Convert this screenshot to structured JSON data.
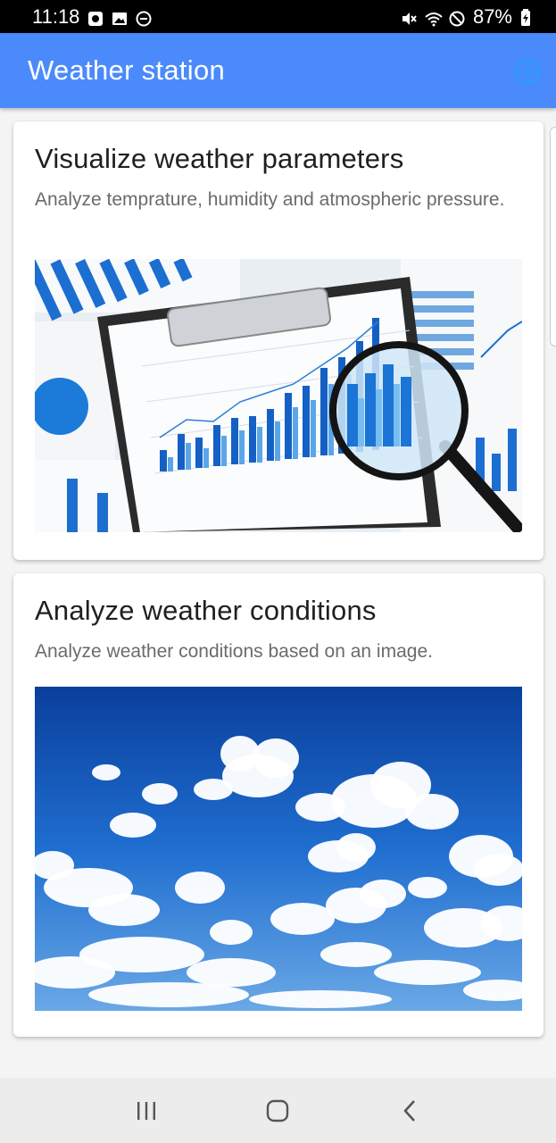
{
  "status_bar": {
    "time": "11:18",
    "battery": "87%",
    "left_icons": [
      "whatsapp-icon",
      "gallery-icon",
      "do-not-disturb-icon"
    ],
    "right_icons": [
      "mute-icon",
      "wifi-icon",
      "blocked-icon",
      "battery-charging-icon"
    ]
  },
  "app_bar": {
    "title": "Weather station",
    "settings_icon": "gear-icon",
    "background": "#4b8afb",
    "icon_color": "#2e9bff"
  },
  "cards": [
    {
      "title": "Visualize weather parameters",
      "subtitle": "Analyze temprature, humidity and atmospheric pressure.",
      "image": "charts-clipboard-magnifier"
    },
    {
      "title": "Analyze weather conditions",
      "subtitle": "Analyze weather conditions based on an image.",
      "image": "blue-sky-clouds"
    }
  ],
  "nav_bar": {
    "buttons": [
      "recent-apps-icon",
      "home-icon",
      "back-icon"
    ]
  }
}
